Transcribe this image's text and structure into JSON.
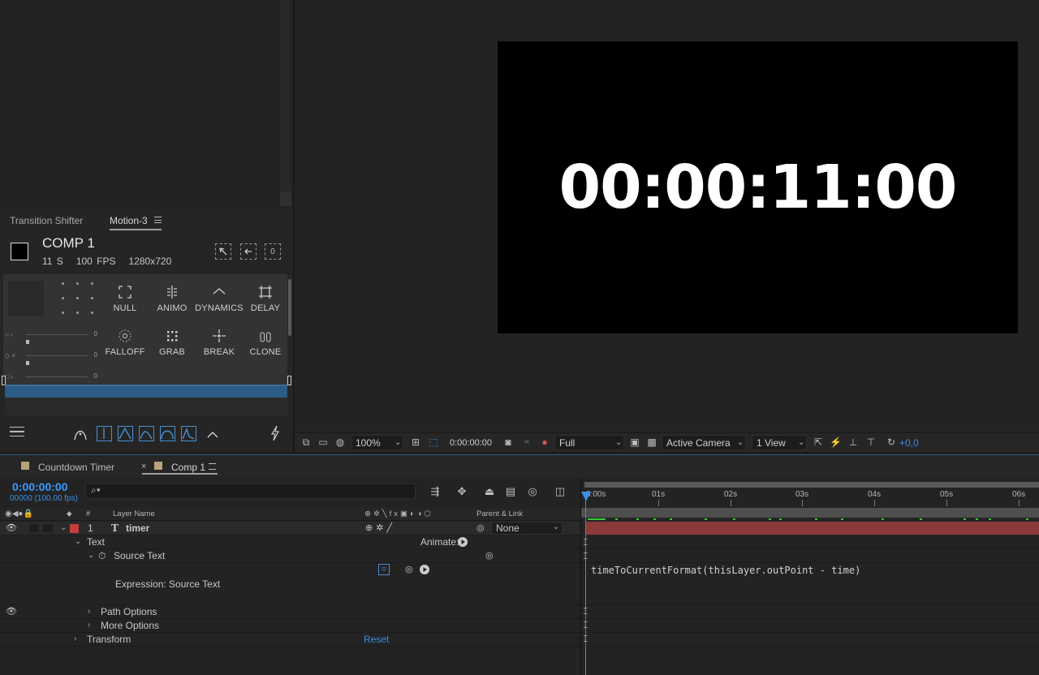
{
  "motion_panel": {
    "tabs": [
      "Transition Shifter",
      "Motion-3"
    ],
    "comp": {
      "title": "COMP 1",
      "duration": "11 S",
      "fps": "100 FPS",
      "resolution": "1280x720"
    },
    "corner_zero": "0",
    "slider_values": [
      "0",
      "0",
      "0"
    ],
    "buttons": [
      {
        "label": "NULL",
        "icon": "null-icon"
      },
      {
        "label": "ANIMO",
        "icon": "animo-icon"
      },
      {
        "label": "DYNAMICS",
        "icon": "dynamics-icon"
      },
      {
        "label": "DELAY",
        "icon": "delay-icon"
      },
      {
        "label": "FALLOFF",
        "icon": "falloff-icon"
      },
      {
        "label": "GRAB",
        "icon": "grab-icon"
      },
      {
        "label": "BREAK",
        "icon": "break-icon"
      },
      {
        "label": "CLONE",
        "icon": "clone-icon"
      }
    ]
  },
  "viewer": {
    "canvas_text": "00:00:11:00",
    "zoom": "100%",
    "timecode": "0:00:00:00",
    "resolution": "Full",
    "camera": "Active Camera",
    "views": "1 View",
    "exposure": "+0,0",
    "accent": "#3a8ee6"
  },
  "timeline": {
    "tabs": [
      "Countdown Timer",
      "Comp 1"
    ],
    "timecode": "0:00:00:00",
    "frames": "00000 (100.00 fps)",
    "columns": {
      "num": "#",
      "layer_name": "Layer Name",
      "parent": "Parent & Link"
    },
    "layer": {
      "index": "1",
      "name": "timer",
      "type_glyph": "T",
      "parent": "None",
      "label_color": "#c63b3b"
    },
    "rows": {
      "text": "Text",
      "animate": "Animate:",
      "source_text": "Source Text",
      "expression_label": "Expression: Source Text",
      "expr_equals": "=",
      "path_options": "Path Options",
      "more_options": "More Options",
      "transform": "Transform",
      "reset": "Reset"
    },
    "ruler": [
      "0:00s",
      "01s",
      "02s",
      "03s",
      "04s",
      "05s",
      "06s"
    ],
    "expression": "timeToCurrentFormat(thisLayer.outPoint - time)"
  }
}
